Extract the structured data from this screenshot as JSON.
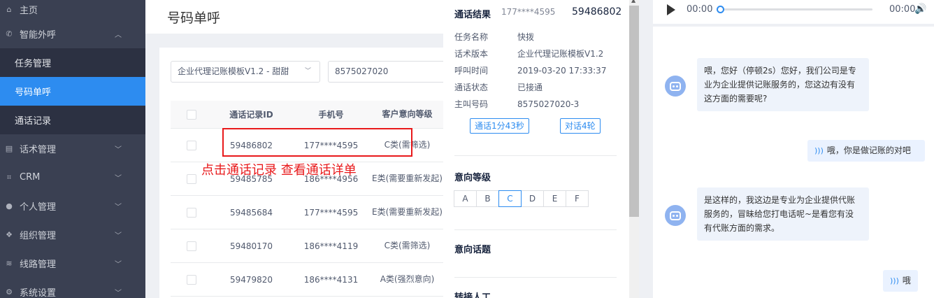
{
  "sidebar": {
    "home": "主页",
    "groups": [
      {
        "label": "智能外呼",
        "icon": "phone-icon",
        "expanded": true
      },
      {
        "label": "话术管理",
        "icon": "book-icon"
      },
      {
        "label": "CRM",
        "icon": "crm-icon"
      },
      {
        "label": "个人管理",
        "icon": "user-icon"
      },
      {
        "label": "组织管理",
        "icon": "team-icon"
      },
      {
        "label": "线路管理",
        "icon": "route-icon"
      },
      {
        "label": "系统设置",
        "icon": "gear-icon"
      }
    ],
    "sub_items": [
      "任务管理",
      "号码单呼",
      "通话记录"
    ],
    "active_sub": "号码单呼"
  },
  "page": {
    "title": "号码单呼"
  },
  "filters": {
    "template_select": "企业代理记账模板V1.2 - 甜甜",
    "phone_input": "8575027020"
  },
  "table": {
    "headers": [
      "通话记录ID",
      "手机号",
      "客户意向等级"
    ],
    "rows": [
      {
        "id": "59486802",
        "phone": "177****4595",
        "intent": "C类(需筛选)"
      },
      {
        "id": "59485785",
        "phone": "186****4956",
        "intent": "E类(需要重新发起)"
      },
      {
        "id": "59485684",
        "phone": "177****4595",
        "intent": "E类(需要重新发起)"
      },
      {
        "id": "59480170",
        "phone": "186****4119",
        "intent": "C类(需筛选)"
      },
      {
        "id": "59479820",
        "phone": "186****4131",
        "intent": "A类(强烈意向)"
      }
    ]
  },
  "annotation": "点击通话记录 查看通话详单",
  "detail": {
    "title": "通话结果",
    "phone": "177****4595",
    "record_id": "59486802",
    "fields": [
      {
        "k": "任务名称",
        "v": "快拨"
      },
      {
        "k": "话术版本",
        "v": "企业代理记账模板V1.2"
      },
      {
        "k": "呼叫时间",
        "v": "2019-03-20 17:33:37"
      },
      {
        "k": "通话状态",
        "v": "已接通"
      },
      {
        "k": "主叫号码",
        "v": "8575027020-3"
      }
    ],
    "duration_btn": "通话1分43秒",
    "rounds_btn": "对话4轮",
    "intent_section": "意向等级",
    "grades": [
      "A",
      "B",
      "C",
      "D",
      "E",
      "F"
    ],
    "selected_grade": "C",
    "topic_section": "意向话题",
    "transfer_section": "转接人工"
  },
  "player": {
    "current": "00:00",
    "total": "00:00",
    "progress": 0
  },
  "chat": [
    {
      "role": "bot",
      "text": "喂，您好（停顿2s）您好，我们公司是专业为企业提供记账服务的，您这边有没有这方面的需要呢?"
    },
    {
      "role": "user",
      "text": "哦，你是做记账的对吧"
    },
    {
      "role": "bot",
      "text": "是这样的，我这边是专业为企业提供代账服务的，冒昧给您打电话呢~是看您有没有代账方面的需求。"
    },
    {
      "role": "user",
      "text": "哦"
    }
  ]
}
